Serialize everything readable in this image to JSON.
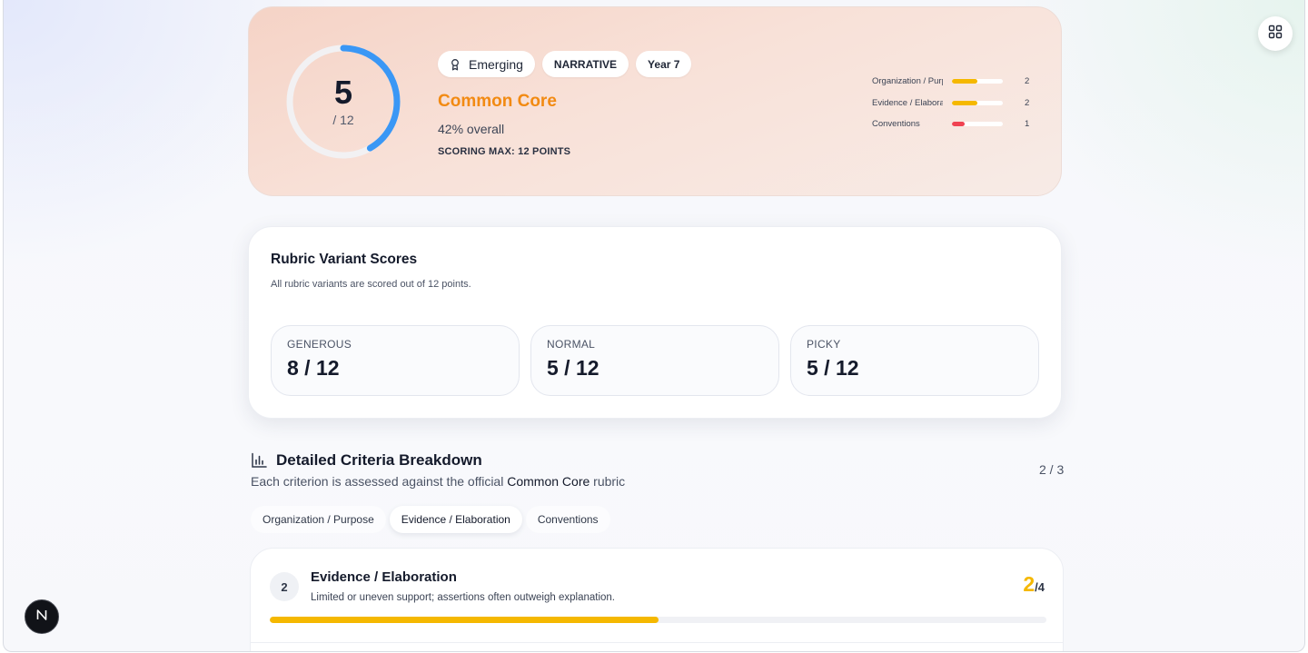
{
  "hero": {
    "score": "5",
    "score_max": "/ 12",
    "score_fraction": 0.4167,
    "chips": {
      "level": "Emerging",
      "genre": "NARRATIVE",
      "year": "Year 7"
    },
    "title": "Common Core",
    "overall": "42% overall",
    "scoring_max": "SCORING MAX: 12 POINTS",
    "criteria": [
      {
        "label": "Organization / Purpose",
        "value": "2",
        "fraction": 0.5,
        "color": "#f5b800"
      },
      {
        "label": "Evidence / Elaboration",
        "value": "2",
        "fraction": 0.5,
        "color": "#f5b800"
      },
      {
        "label": "Conventions",
        "value": "1",
        "fraction": 0.25,
        "color": "#f04352"
      }
    ]
  },
  "rubric": {
    "title": "Rubric Variant Scores",
    "subtitle": "All rubric variants are scored out of 12 points.",
    "variants": [
      {
        "label": "GENEROUS",
        "value": "8 / 12"
      },
      {
        "label": "NORMAL",
        "value": "5 / 12"
      },
      {
        "label": "PICKY",
        "value": "5 / 12"
      }
    ]
  },
  "criteria_section": {
    "title": "Detailed Criteria Breakdown",
    "subtitle_prefix": "Each criterion is assessed against the official ",
    "subtitle_strong": "Common Core",
    "subtitle_suffix": " rubric",
    "page": "2 / 3",
    "tabs": [
      "Organization / Purpose",
      "Evidence / Elaboration",
      "Conventions"
    ],
    "active_tab": 1,
    "detail": {
      "number": "2",
      "title": "Evidence / Elaboration",
      "description": "Limited or uneven support; assertions often outweigh explanation.",
      "score": "2",
      "score_of": "/4",
      "fraction": 0.5
    }
  },
  "icons": {
    "grid_button": "grid-icon",
    "next_badge": "N",
    "level_badge": "award-icon",
    "section_icon": "bar-chart-icon"
  },
  "colors": {
    "ring": "#3a97f5",
    "accent_orange": "#f28a12",
    "accent_yellow": "#f5b800",
    "accent_red": "#f04352"
  }
}
